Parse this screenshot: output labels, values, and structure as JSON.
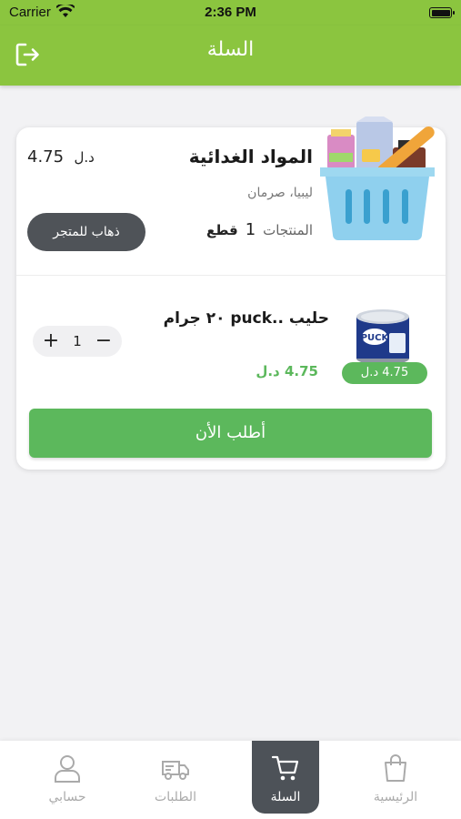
{
  "status_bar": {
    "carrier": "Carrier",
    "time": "2:36 PM"
  },
  "header": {
    "title": "السلة",
    "logout_icon": "logout-icon"
  },
  "cart": {
    "store": {
      "name": "المواد الغدائية",
      "location": "ليبيا، صرمان",
      "products_label": "المنتجات",
      "products_count": "1",
      "products_unit": "قطع",
      "total_value": "4.75",
      "total_currency": "د.ل",
      "goto_store_label": "ذهاب للمتجر",
      "image_icon": "grocery-basket-icon"
    },
    "item": {
      "name": "حليب ..puck ٢٠ جرام",
      "price": "4.75 د.ل",
      "badge_price": "4.75 د.ل",
      "quantity": "1",
      "plus": "+",
      "minus": "−",
      "image_icon": "milk-can-icon"
    },
    "order_button_label": "أطلب الأن"
  },
  "tabs": [
    {
      "label": "الرئيسية",
      "icon": "shopping-bag-icon",
      "active": false
    },
    {
      "label": "السلة",
      "icon": "cart-icon",
      "active": true
    },
    {
      "label": "الطلبات",
      "icon": "delivery-truck-icon",
      "active": false
    },
    {
      "label": "حسابي",
      "icon": "user-icon",
      "active": false
    }
  ],
  "colors": {
    "primary_green": "#8bc53f",
    "button_green": "#5cb85c",
    "dark_button": "#4f5358"
  }
}
